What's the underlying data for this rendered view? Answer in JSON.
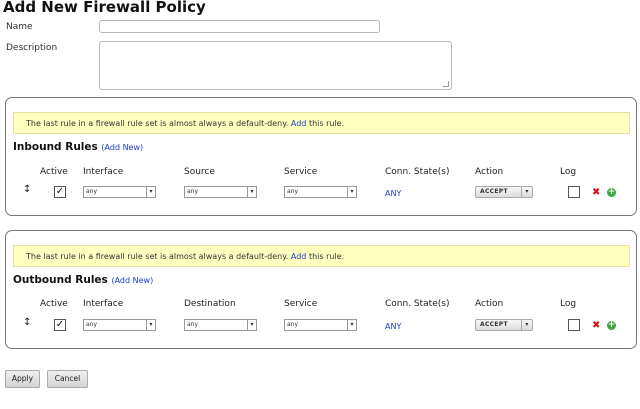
{
  "page": {
    "title": "Add New Firewall Policy"
  },
  "form": {
    "name_label": "Name",
    "name_value": "",
    "description_label": "Description",
    "description_value": ""
  },
  "inbound": {
    "notice": {
      "before": "The last rule in a firewall rule set is almost always a default-deny.",
      "link": "Add",
      "after": "this rule."
    },
    "title": "Inbound Rules",
    "add_new": "(Add New)",
    "columns": {
      "active": "Active",
      "interface": "Interface",
      "source": "Source",
      "service": "Service",
      "conn_state": "Conn. State(s)",
      "action": "Action",
      "log": "Log"
    },
    "row": {
      "active": true,
      "interface": "any",
      "source": "any",
      "service": "any",
      "conn_state": "ANY",
      "action": "ACCEPT",
      "log": false
    }
  },
  "outbound": {
    "notice": {
      "before": "The last rule in a firewall rule set is almost always a default-deny.",
      "link": "Add",
      "after": "this rule."
    },
    "title": "Outbound Rules",
    "add_new": "(Add New)",
    "columns": {
      "active": "Active",
      "interface": "Interface",
      "destination": "Destination",
      "service": "Service",
      "conn_state": "Conn. State(s)",
      "action": "Action",
      "log": "Log"
    },
    "row": {
      "active": true,
      "interface": "any",
      "destination": "any",
      "service": "any",
      "conn_state": "ANY",
      "action": "ACCEPT",
      "log": false
    }
  },
  "buttons": {
    "apply": "Apply",
    "cancel": "Cancel"
  },
  "glyphs": {
    "drag": "↕",
    "check": "✓",
    "dropdown": "▾",
    "delete": "✖",
    "add": "+"
  },
  "colors": {
    "notice_bg": "#ffffc0",
    "link": "#1a3cc8",
    "delete": "#dd1111",
    "add": "#3aa83a"
  }
}
